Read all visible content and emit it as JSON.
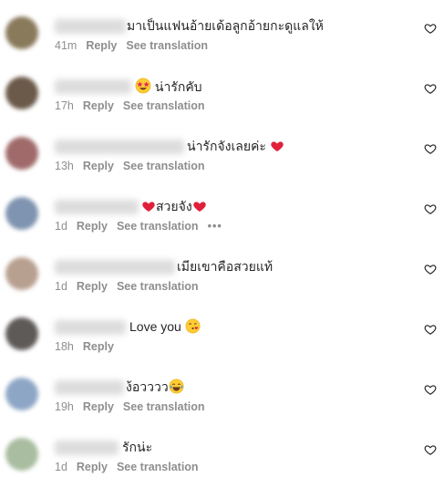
{
  "comments": [
    {
      "text": "มาเป็นแฟนอ้ายเด้อลูกอ้ายกะดูแลให้",
      "emoji_after": "",
      "emoji_before": "",
      "time": "41m",
      "reply": "Reply",
      "translate": "See translation",
      "more": "",
      "avatar_color": "#8a7a5c"
    },
    {
      "text": "น่ารักคับ",
      "emoji_before": "star-struck-emoji",
      "emoji_after": "",
      "time": "17h",
      "reply": "Reply",
      "translate": "See translation",
      "more": "",
      "avatar_color": "#6b5a4a"
    },
    {
      "text": "น่ารักจังเลยค่ะ",
      "emoji_before": "",
      "emoji_after": "red-heart-emoji",
      "time": "13h",
      "reply": "Reply",
      "translate": "See translation",
      "more": "",
      "avatar_color": "#a06a6a"
    },
    {
      "text": "สวยจัง",
      "emoji_before": "red-heart-emoji",
      "emoji_after": "red-heart-emoji",
      "time": "1d",
      "reply": "Reply",
      "translate": "See translation",
      "more": "•••",
      "avatar_color": "#7f94b0"
    },
    {
      "text": "เมียเขาคือสวยแท้",
      "emoji_before": "",
      "emoji_after": "",
      "time": "1d",
      "reply": "Reply",
      "translate": "See translation",
      "more": "",
      "avatar_color": "#b8a090"
    },
    {
      "text": "Love you",
      "emoji_before": "",
      "emoji_after": "kissing-face-emoji",
      "time": "18h",
      "reply": "Reply",
      "translate": "",
      "more": "",
      "avatar_color": "#5e5a58"
    },
    {
      "text": "ง้อวววว",
      "emoji_before": "",
      "emoji_after": "tears-of-joy-emoji",
      "time": "19h",
      "reply": "Reply",
      "translate": "See translation",
      "more": "",
      "avatar_color": "#8ea6c6"
    },
    {
      "text": "รักน่ะ",
      "emoji_before": "",
      "emoji_after": "",
      "time": "1d",
      "reply": "Reply",
      "translate": "See translation",
      "more": "",
      "avatar_color": "#a9bda0"
    }
  ]
}
